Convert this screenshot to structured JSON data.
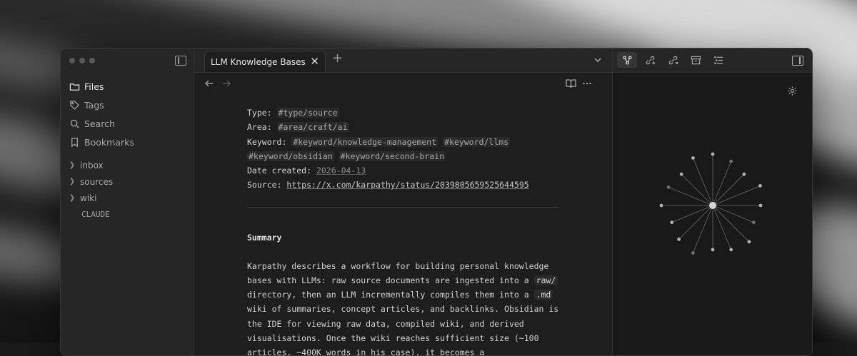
{
  "sidebar": {
    "nav": [
      {
        "label": "Files",
        "icon": "folder-icon",
        "active": true
      },
      {
        "label": "Tags",
        "icon": "tag-icon",
        "active": false
      },
      {
        "label": "Search",
        "icon": "search-icon",
        "active": false
      },
      {
        "label": "Bookmarks",
        "icon": "bookmark-icon",
        "active": false
      }
    ],
    "folders": [
      "inbox",
      "sources",
      "wiki"
    ],
    "files": [
      "CLAUDE"
    ]
  },
  "tab": {
    "title": "LLM Knowledge Bases...",
    "new_tab_label": "+"
  },
  "note": {
    "properties": {
      "type_label": "Type:",
      "type_tag": "#type/source",
      "area_label": "Area:",
      "area_tag": "#area/craft/ai",
      "keyword_label": "Keyword:",
      "keywords": [
        "#keyword/knowledge-management",
        "#keyword/llms",
        "#keyword/obsidian",
        "#keyword/second-brain"
      ],
      "date_label": "Date created:",
      "date_value": "2026-04-13",
      "source_label": "Source:",
      "source_url": "https://x.com/karpathy/status/2039805659525644595"
    },
    "summary_heading": "Summary",
    "paragraph": {
      "t1": "Karpathy describes a workflow for building personal knowledge bases with LLMs: raw source documents are ingested into a ",
      "code1": "raw/",
      "t2": " directory, then an LLM incrementally compiles them into a ",
      "code2": ".md",
      "t3": " wiki of summaries, concept articles, and backlinks. Obsidian is the IDE for viewing raw data, compiled wiki, and derived visualisations. Once the wiki reaches sufficient size (~100 articles, ~400K words in his case), it becomes a"
    }
  },
  "right_panel": {
    "icons": [
      "graph-view-icon",
      "backlinks-icon",
      "outgoing-links-icon",
      "archive-icon",
      "outline-icon"
    ],
    "graph": {
      "center_label": "",
      "leaf_count": 16
    }
  },
  "colors": {
    "accent": "#e0e0e0",
    "background": "#1e1e1e"
  }
}
